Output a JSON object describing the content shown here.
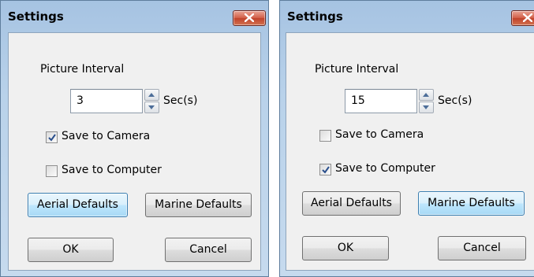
{
  "dialogs": [
    {
      "title": "Settings",
      "interval_label": "Picture Interval",
      "interval_value": "3",
      "unit_label": "Sec(s)",
      "save_camera_label": "Save to Camera",
      "save_camera_checked": true,
      "save_computer_label": "Save to Computer",
      "save_computer_checked": false,
      "aerial_label": "Aerial Defaults",
      "marine_label": "Marine Defaults",
      "active_preset": "aerial",
      "ok_label": "OK",
      "cancel_label": "Cancel"
    },
    {
      "title": "Settings",
      "interval_label": "Picture Interval",
      "interval_value": "15",
      "unit_label": "Sec(s)",
      "save_camera_label": "Save to Camera",
      "save_camera_checked": false,
      "save_computer_label": "Save to Computer",
      "save_computer_checked": true,
      "aerial_label": "Aerial Defaults",
      "marine_label": "Marine Defaults",
      "active_preset": "marine",
      "ok_label": "OK",
      "cancel_label": "Cancel"
    }
  ],
  "colors": {
    "accent_active_button": "#bee6fd",
    "close_button": "#c1432b",
    "title_bar": "#b9d2ea",
    "client_background": "#f0f0f0"
  },
  "icons": [
    "close-icon",
    "spin-up-icon",
    "spin-down-icon",
    "checkmark-icon"
  ]
}
